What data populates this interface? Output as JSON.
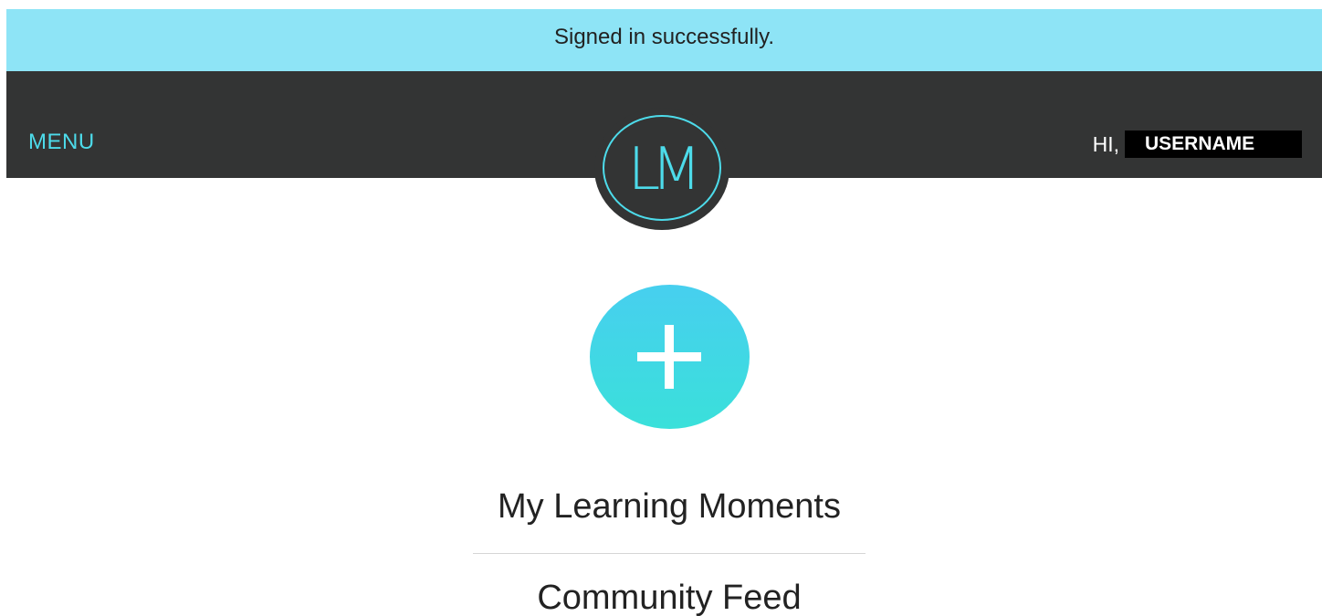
{
  "flash": {
    "message": "Signed in successfully."
  },
  "header": {
    "menu_label": "MENU",
    "greeting": "HI,",
    "username": "USERNAME",
    "logo_text": "LM"
  },
  "main": {
    "add_icon": "plus-icon",
    "links": [
      {
        "label": "My Learning Moments"
      },
      {
        "label": "Community Feed"
      }
    ]
  },
  "colors": {
    "flash_bg": "#8ee4f6",
    "header_bg": "#333434",
    "accent": "#4ddbea",
    "button_gradient_top": "#47cfef",
    "button_gradient_bottom": "#3ae0da"
  }
}
